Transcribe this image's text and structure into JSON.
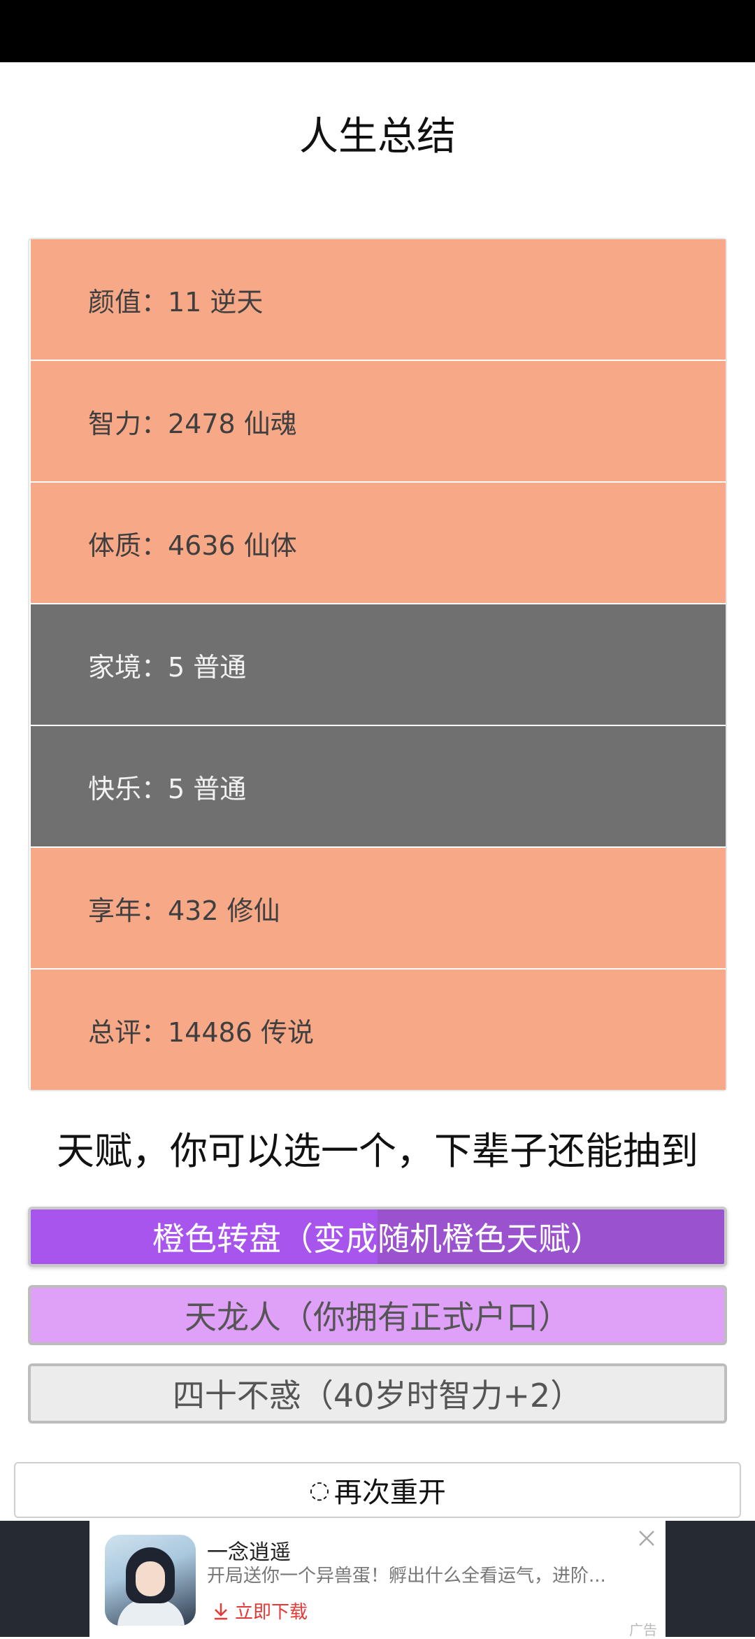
{
  "page": {
    "title": "人生总结"
  },
  "stats": [
    {
      "label": "颜值：11 逆天",
      "level": "high"
    },
    {
      "label": "智力：2478 仙魂",
      "level": "high"
    },
    {
      "label": "体质：4636 仙体",
      "level": "high"
    },
    {
      "label": "家境：5 普通",
      "level": "normal"
    },
    {
      "label": "快乐：5 普通",
      "level": "normal"
    },
    {
      "label": "享年：432 修仙",
      "level": "high"
    },
    {
      "label": "总评：14486 传说",
      "level": "high"
    }
  ],
  "talents": {
    "heading": "天赋，你可以选一个，下辈子还能抽到",
    "options": [
      {
        "label": "橙色转盘（变成随机橙色天赋）",
        "rarity": "orange"
      },
      {
        "label": "天龙人（你拥有正式户口）",
        "rarity": "purple"
      },
      {
        "label": "四十不惑（40岁时智力+2）",
        "rarity": "common"
      }
    ]
  },
  "restart": {
    "icon": "refresh-icon",
    "label": "再次重开"
  },
  "ad": {
    "app_name": "一念逍遥",
    "description": "开局送你一个异兽蛋！孵出什么全看运气，进阶...",
    "download_label": "立即下载",
    "tag": "广告"
  },
  "colors": {
    "high": "#f7a887",
    "normal": "#707070",
    "orange_talent": "#a855ee",
    "purple_talent": "#dfa0f7",
    "common_talent": "#ececec"
  }
}
